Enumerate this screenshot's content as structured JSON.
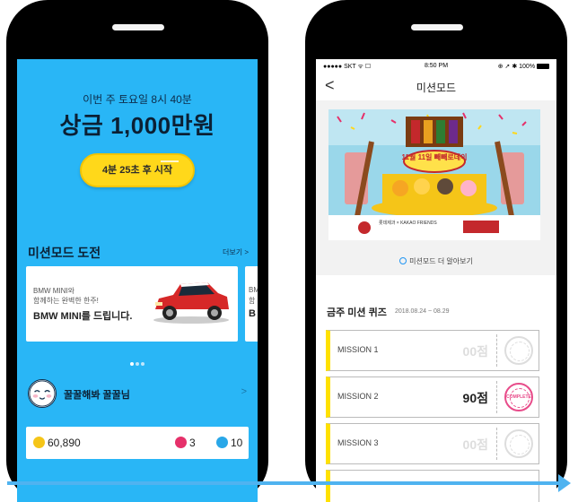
{
  "left_screen": {
    "schedule": "이번 주 토요일 8시 40분",
    "prize": "상금 1,000만원",
    "start_button": "4분 25초 후 시작",
    "section_title": "미션모드 도전",
    "more_link": "더보기 >",
    "card": {
      "line1": "BMW MINI와",
      "line2": "함께하는 완벽한 한주!",
      "title": "BMW MINI를 드립니다."
    },
    "card_peek": {
      "line1": "BM",
      "line2": "함",
      "title": "B"
    },
    "profile": {
      "name": "꿀꿀해봐 꿀꿀님",
      "chevron": ">"
    },
    "stats": {
      "coins": "60,890",
      "hearts": "3",
      "tickets": "10"
    },
    "colors": {
      "bg": "#29b6f6",
      "button": "#ffd81a"
    },
    "icons": [
      "coin-icon",
      "heart-icon",
      "ticket-icon",
      "car-image",
      "avatar-face"
    ]
  },
  "right_screen": {
    "status_bar": {
      "carrier": "●●●●● SKT ᯤ ☐",
      "time": "8:50 PM",
      "right": "⊕ ➚ ✱ 100%"
    },
    "nav": {
      "back": "<",
      "title": "미션모드"
    },
    "banner_text": {
      "headline": "11월 11일 빼빼로데이",
      "sub": "롯데제과 × KAKAO FRIENDS"
    },
    "learn_more": "미션모드 더 알아보기",
    "quiz": {
      "title": "금주 미션 퀴즈",
      "date": "2018.08.24 ~ 08.29"
    },
    "missions": [
      {
        "label": "MISSION 1",
        "score": "00점",
        "active": false
      },
      {
        "label": "MISSION 2",
        "score": "90점",
        "active": true,
        "stamp": "COMPLETE"
      },
      {
        "label": "MISSION 3",
        "score": "00점",
        "active": false
      }
    ]
  }
}
